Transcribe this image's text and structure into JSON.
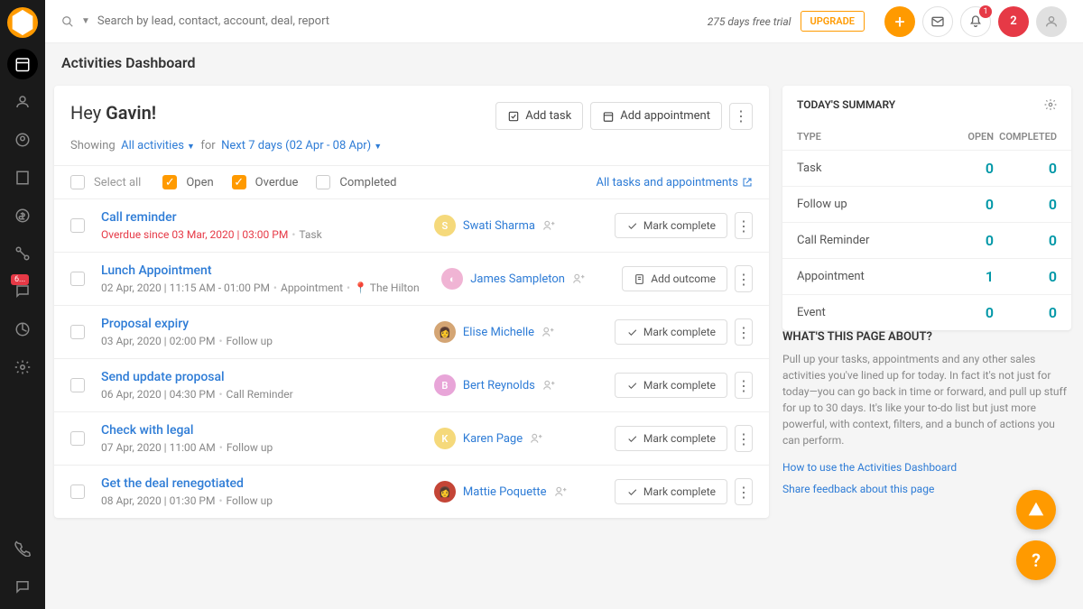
{
  "header": {
    "search_placeholder": "Search by lead, contact, account, deal, report",
    "trial_text": "275 days free trial",
    "upgrade": "UPGRADE",
    "notif_count": "1",
    "badge_count": "2"
  },
  "sidebar": {
    "conversation_badge": "6..."
  },
  "page": {
    "title": "Activities Dashboard",
    "greeting_pre": "Hey ",
    "greeting_name": "Gavin!",
    "add_task": "Add task",
    "add_appointment": "Add appointment",
    "showing": "Showing",
    "activities_filter": "All activities",
    "for_text": "for",
    "date_filter": "Next 7 days (02 Apr - 08 Apr)",
    "select_all": "Select all",
    "open": "Open",
    "overdue": "Overdue",
    "completed": "Completed",
    "all_link": "All tasks and appointments"
  },
  "activities": [
    {
      "title": "Call reminder",
      "meta": "Overdue since 03 Mar, 2020 | 03:00 PM",
      "type": "Task",
      "overdue": true,
      "person": "Swati Sharma",
      "avatar": "S",
      "color": "#f5d97b",
      "action": "Mark complete",
      "action_icon": "check"
    },
    {
      "title": "Lunch Appointment",
      "meta": "02 Apr, 2020 | 11:15 AM - 01:00 PM",
      "type": "Appointment",
      "location": "The Hilton",
      "person": "James Sampleton",
      "avatar": "◐",
      "color": "#f0b4d4",
      "action": "Add outcome",
      "action_icon": "doc"
    },
    {
      "title": "Proposal expiry",
      "meta": "03 Apr, 2020 | 02:00 PM",
      "type": "Follow up",
      "person": "Elise Michelle",
      "avatar": "👩",
      "color": "#d4a574",
      "action": "Mark complete",
      "action_icon": "check"
    },
    {
      "title": "Send update proposal",
      "meta": "06 Apr, 2020 | 04:30 PM",
      "type": "Call Reminder",
      "person": "Bert Reynolds",
      "avatar": "B",
      "color": "#e8a5d8",
      "action": "Mark complete",
      "action_icon": "check"
    },
    {
      "title": "Check with legal",
      "meta": "07 Apr, 2020 | 11:00 AM",
      "type": "Follow up",
      "person": "Karen Page",
      "avatar": "K",
      "color": "#f5d97b",
      "action": "Mark complete",
      "action_icon": "check"
    },
    {
      "title": "Get the deal renegotiated",
      "meta": "08 Apr, 2020 | 01:30 PM",
      "type": "Follow up",
      "person": "Mattie Poquette",
      "avatar": "👩",
      "color": "#c44536",
      "action": "Mark complete",
      "action_icon": "check"
    }
  ],
  "summary": {
    "title": "TODAY'S SUMMARY",
    "head_type": "TYPE",
    "head_open": "OPEN",
    "head_completed": "COMPLETED",
    "rows": [
      {
        "label": "Task",
        "open": "0",
        "completed": "0"
      },
      {
        "label": "Follow up",
        "open": "0",
        "completed": "0"
      },
      {
        "label": "Call Reminder",
        "open": "0",
        "completed": "0"
      },
      {
        "label": "Appointment",
        "open": "1",
        "completed": "0"
      },
      {
        "label": "Event",
        "open": "0",
        "completed": "0"
      }
    ]
  },
  "about": {
    "title": "WHAT'S THIS PAGE ABOUT?",
    "text": "Pull up your tasks, appointments and any other sales activities you've lined up for today. In fact it's not just for today—you can go back in time or forward, and pull up stuff for up to 30 days. It's like your to-do list but just more powerful, with context, filters, and a bunch of actions you can perform.",
    "link1": "How to use the Activities Dashboard",
    "link2": "Share feedback about this page"
  }
}
